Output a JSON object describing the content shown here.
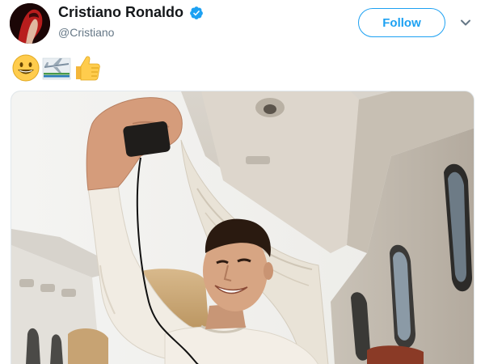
{
  "user": {
    "display_name": "Cristiano Ronaldo",
    "handle": "@Cristiano",
    "verified": true
  },
  "actions": {
    "follow_label": "Follow"
  },
  "icons": {
    "verified": "verified-badge-icon",
    "caret": "chevron-down-icon",
    "emojis": [
      "grinning-face-emoji",
      "airplane-emoji",
      "thumbs-up-emoji"
    ]
  },
  "colors": {
    "accent": "#1da1f2",
    "text": "#14171a",
    "muted": "#657786"
  }
}
